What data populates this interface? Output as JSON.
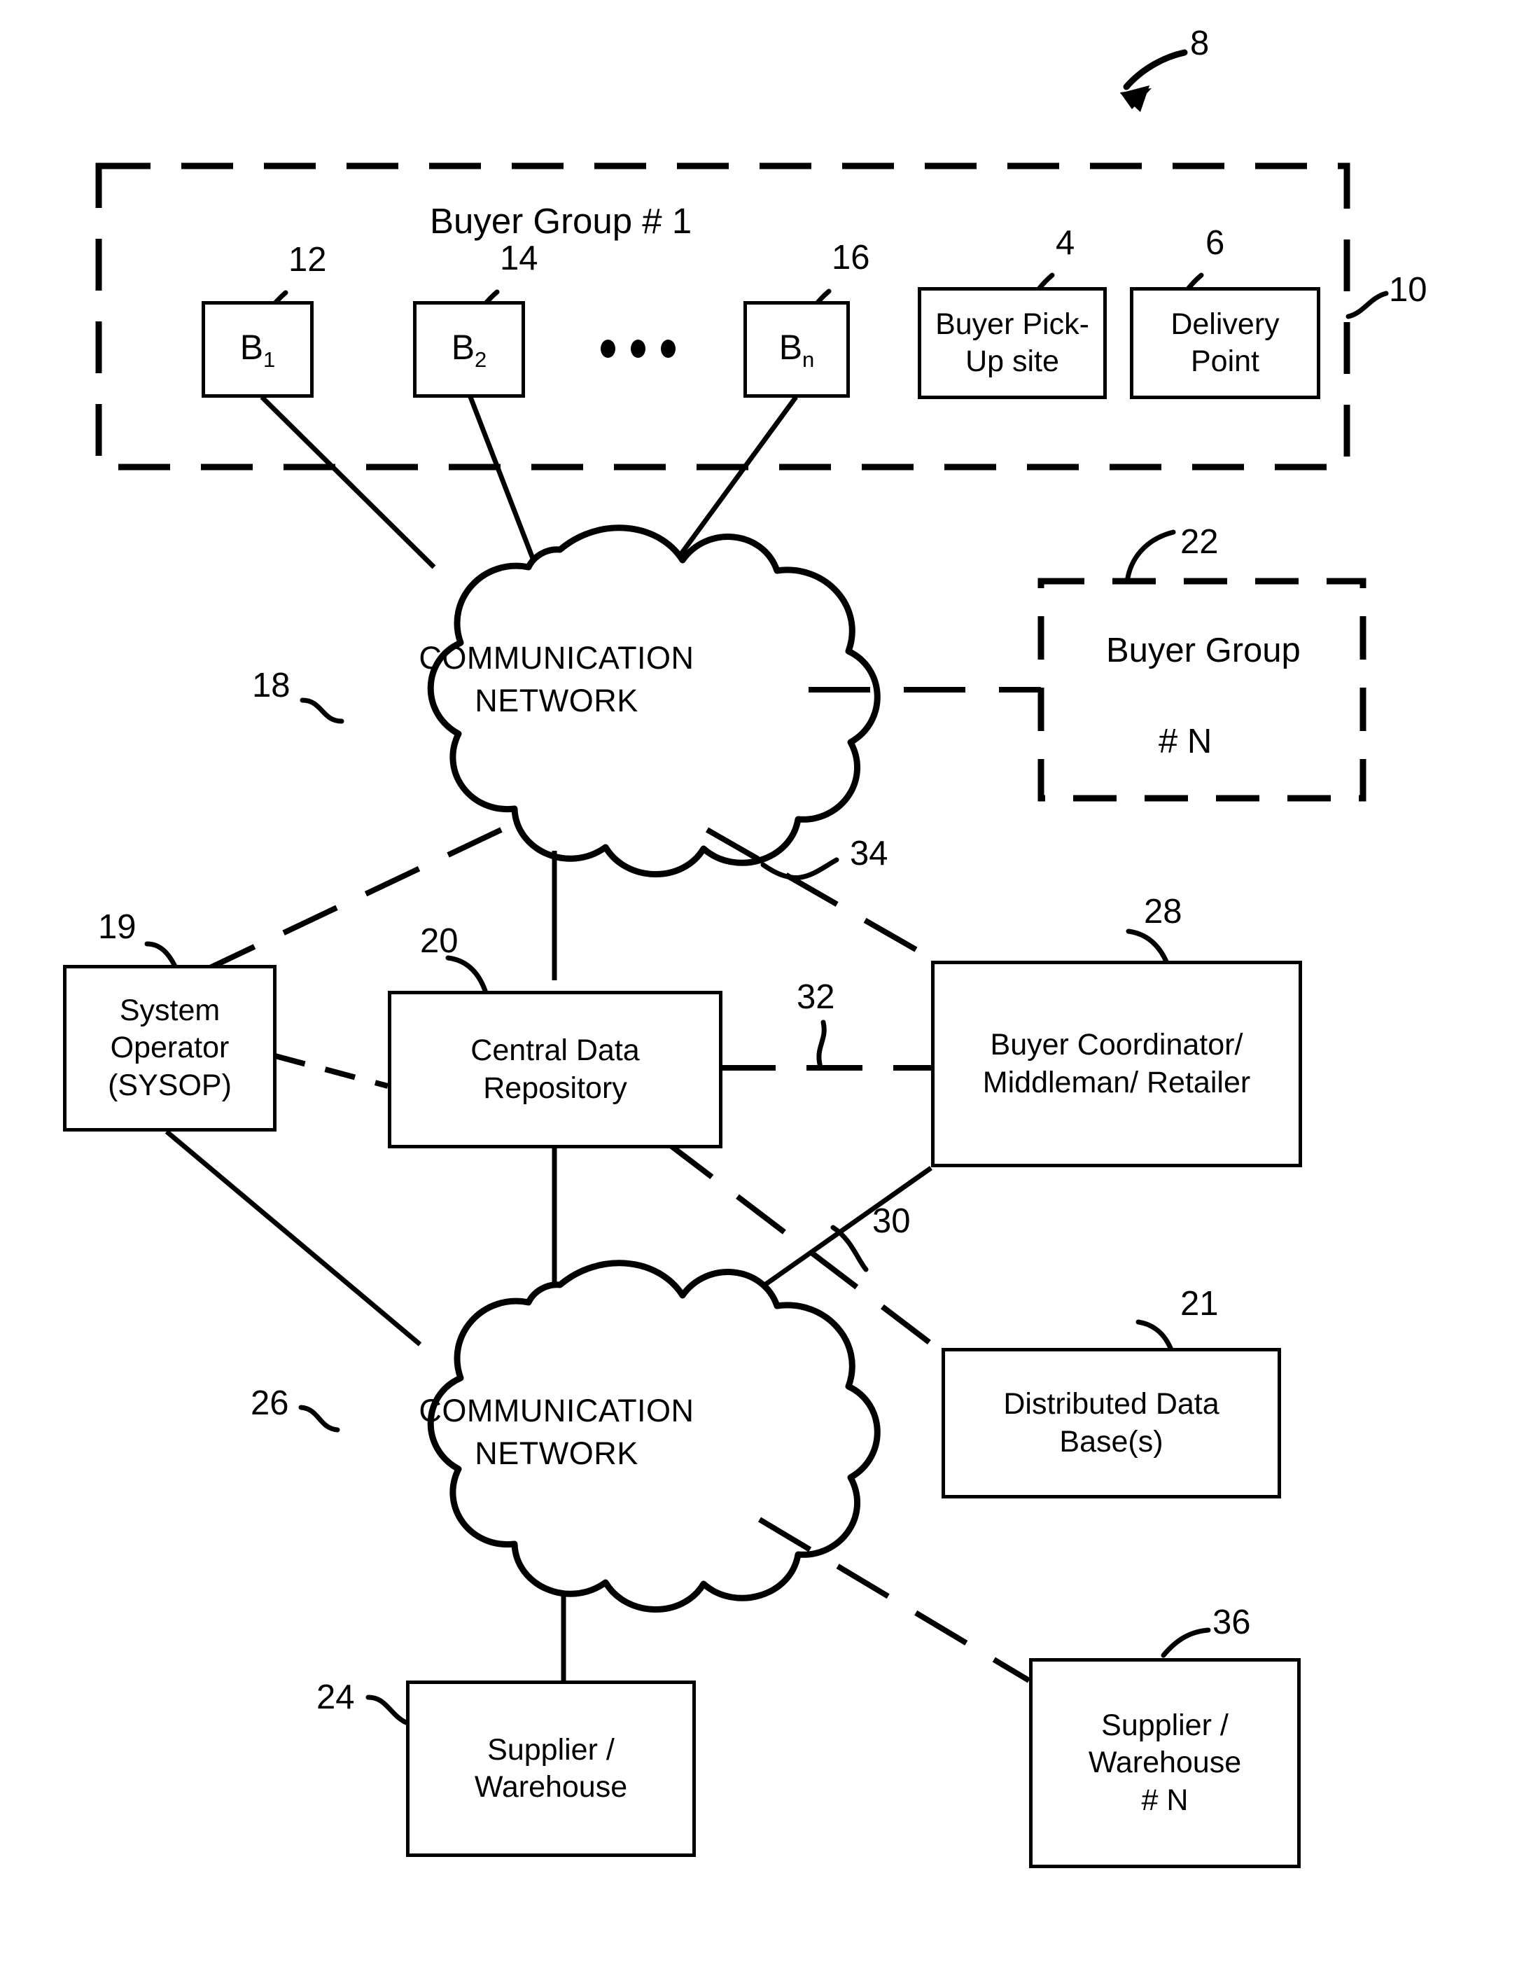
{
  "figure": {
    "label": "8",
    "title_arrow": "curved-arrow-icon"
  },
  "buyer_group_1": {
    "title": "Buyer Group # 1",
    "ref": "10",
    "boundary_style": "dashed",
    "buyers": [
      {
        "label": "B",
        "subscript": "1",
        "ref": "12"
      },
      {
        "label": "B",
        "subscript": "2",
        "ref": "14"
      },
      {
        "label": "B",
        "subscript": "n",
        "ref": "16"
      }
    ],
    "ellipsis": "• • •",
    "sites": [
      {
        "label": "Buyer Pick-\nUp site",
        "ref": "4"
      },
      {
        "label": "Delivery\nPoint",
        "ref": "6"
      }
    ]
  },
  "network_top": {
    "label": "COMMUNICATION\nNETWORK",
    "ref": "18"
  },
  "network_bottom": {
    "label": "COMMUNICATION\nNETWORK",
    "ref": "26"
  },
  "buyer_group_n": {
    "line1": "Buyer Group",
    "line2": "# N",
    "ref": "22",
    "boundary_style": "dashed"
  },
  "nodes": {
    "system_operator": {
      "label": "System\nOperator\n(SYSOP)",
      "ref": "19"
    },
    "central_data_repository": {
      "label": "Central Data\nRepository",
      "ref": "20"
    },
    "buyer_coordinator": {
      "label": "Buyer Coordinator/\nMiddleman/ Retailer",
      "ref": "28"
    },
    "distributed_database": {
      "label": "Distributed Data\nBase(s)",
      "ref": "21"
    },
    "supplier_warehouse": {
      "label": "Supplier /\nWarehouse",
      "ref": "24"
    },
    "supplier_warehouse_n": {
      "label": "Supplier /\nWarehouse\n# N",
      "ref": "36"
    }
  },
  "connection_refs": {
    "coordinator_to_network_top": "34",
    "repository_to_coordinator": "32",
    "coordinator_to_network_bottom": "30"
  },
  "colors": {
    "stroke": "#000000",
    "background": "#ffffff"
  }
}
